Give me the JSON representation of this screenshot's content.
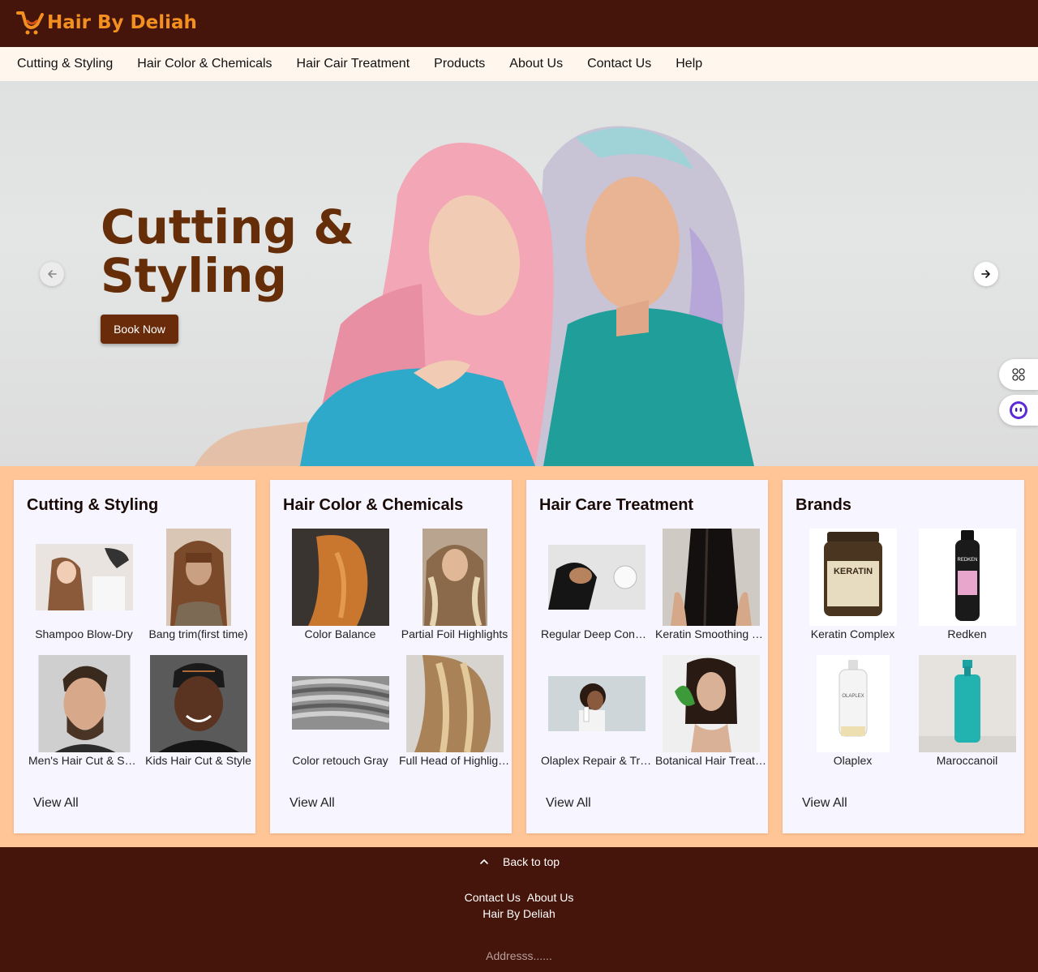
{
  "header": {
    "brand": "Hair By Deliah",
    "icon": "cart-smile-logo-icon"
  },
  "nav": {
    "items": [
      {
        "label": "Cutting & Styling"
      },
      {
        "label": "Hair Color & Chemicals"
      },
      {
        "label": "Hair Cair Treatment"
      },
      {
        "label": "Products"
      },
      {
        "label": "About Us"
      },
      {
        "label": "Contact Us"
      },
      {
        "label": "Help"
      }
    ]
  },
  "hero": {
    "title": "Cutting & Styling",
    "cta_label": "Book Now",
    "prev_icon": "arrow-left-icon",
    "next_icon": "arrow-right-icon"
  },
  "side_tools": {
    "apps_icon": "apps-grid-icon",
    "assistant_icon": "assistant-bot-icon"
  },
  "cards": [
    {
      "title": "Cutting & Styling",
      "items": [
        {
          "caption": "Shampoo Blow-Dry"
        },
        {
          "caption": "Bang trim(first time)"
        },
        {
          "caption": "Men's Hair Cut & Shave"
        },
        {
          "caption": "Kids Hair Cut & Style"
        }
      ],
      "view_all": "View All"
    },
    {
      "title": "Hair Color & Chemicals",
      "items": [
        {
          "caption": "Color Balance"
        },
        {
          "caption": "Partial Foil Highlights"
        },
        {
          "caption": "Color retouch Gray"
        },
        {
          "caption": "Full Head of Highlights"
        }
      ],
      "view_all": "View All"
    },
    {
      "title": "Hair Care Treatment",
      "items": [
        {
          "caption": "Regular Deep Conditioning"
        },
        {
          "caption": "Keratin Smoothing Treatment"
        },
        {
          "caption": "Olaplex Repair & Treatment"
        },
        {
          "caption": "Botanical Hair Treatment"
        }
      ],
      "view_all": "View All"
    },
    {
      "title": "Brands",
      "items": [
        {
          "caption": "Keratin Complex",
          "product_label": "KERATIN"
        },
        {
          "caption": "Redken",
          "product_label": "REDKEN"
        },
        {
          "caption": "Olaplex",
          "product_label": "OLAPLEX"
        },
        {
          "caption": "Maroccanoil"
        }
      ],
      "view_all": "View All"
    }
  ],
  "footer": {
    "back_to_top": "Back to top",
    "links": [
      "Contact Us",
      "About Us"
    ],
    "brand": "Hair By Deliah",
    "address": "Addresss......"
  }
}
